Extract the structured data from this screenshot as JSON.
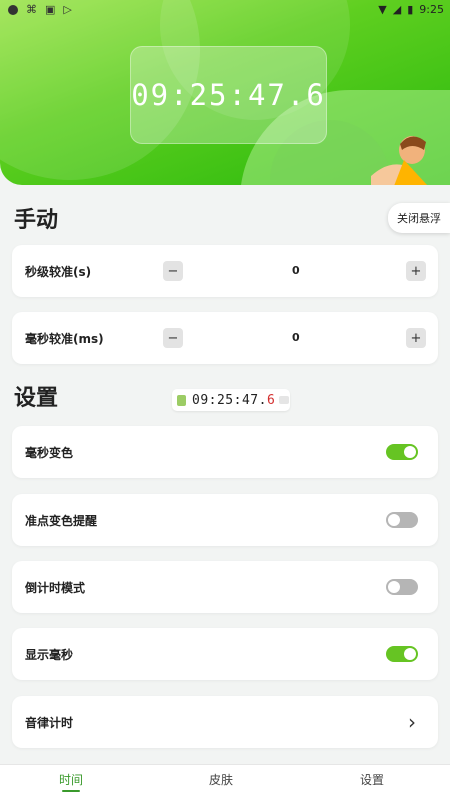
{
  "status_bar": {
    "time": "9:25"
  },
  "hero": {
    "timer": "09:25:47.6"
  },
  "manual": {
    "title": "手动",
    "float_button": "关闭悬浮",
    "rows": [
      {
        "label": "秒级较准(s)",
        "value": "0",
        "minus": "−",
        "plus": "+"
      },
      {
        "label": "毫秒较准(ms)",
        "value": "0",
        "minus": "−",
        "plus": "+"
      }
    ]
  },
  "settings": {
    "title": "设置",
    "preview": {
      "time": "09:25:47.",
      "ms": "6",
      "ms_color": "#d32f2f"
    },
    "items": [
      {
        "label": "毫秒变色",
        "state": "on"
      },
      {
        "label": "准点变色提醒",
        "state": "off"
      },
      {
        "label": "倒计时模式",
        "state": "off"
      },
      {
        "label": "显示毫秒",
        "state": "on"
      },
      {
        "label": "音律计时",
        "chevron": "›"
      }
    ]
  },
  "bottom_nav": {
    "tabs": [
      "时间",
      "皮肤",
      "设置"
    ],
    "active": 0,
    "accent": "#3a9a2c"
  },
  "colors": {
    "toggle_on": "#66c423",
    "toggle_off": "#b5b5b5"
  }
}
